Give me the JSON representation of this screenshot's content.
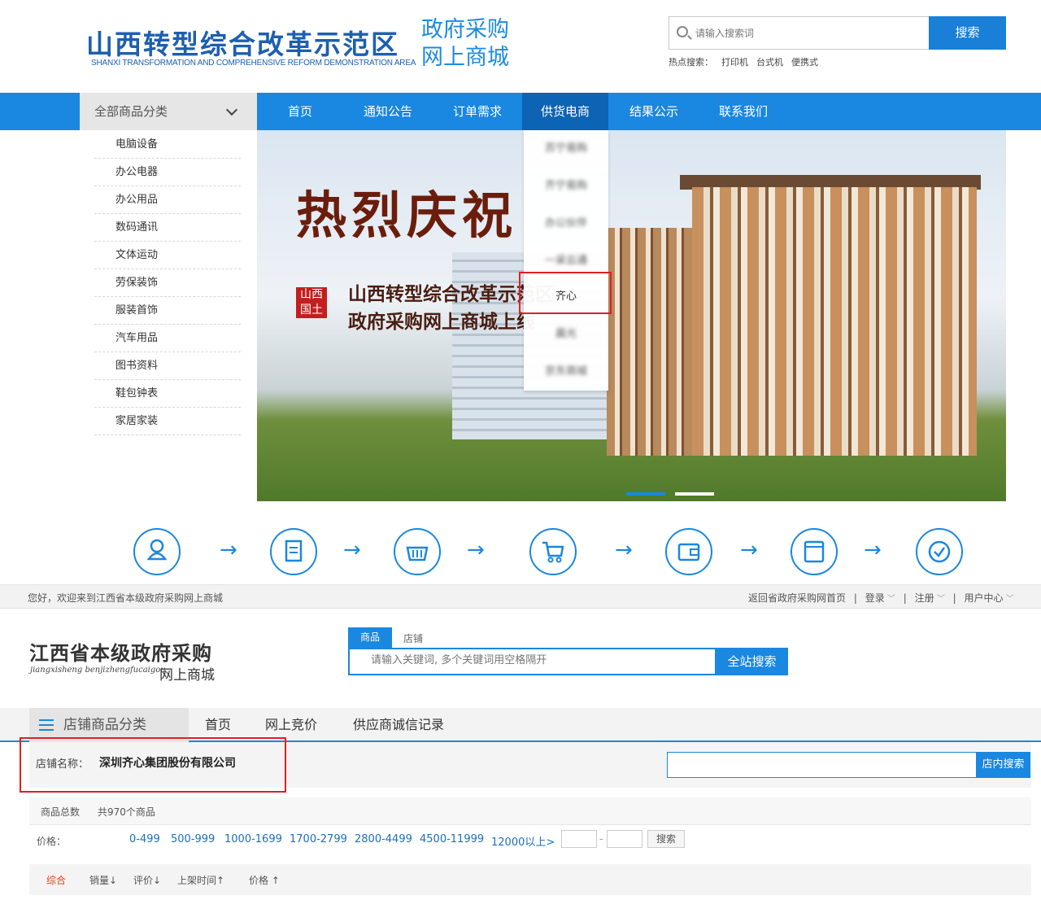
{
  "site1": {
    "logo_cn": "山西转型综合改革示范区",
    "logo_en": "SHANXI TRANSFORMATION AND COMPREHENSIVE REFORM DEMONSTRATION AREA",
    "logo_sub_line1": "政府采购",
    "logo_sub_line2": "网上商城",
    "search": {
      "placeholder": "请输入搜索词",
      "button": "搜索"
    },
    "hot_search_label": "热点搜索：",
    "hot_search": [
      "打印机",
      "台式机",
      "便携式"
    ],
    "category_header": "全部商品分类",
    "nav": [
      "首页",
      "通知公告",
      "订单需求",
      "供货电商",
      "结果公示",
      "联系我们"
    ],
    "nav_active": "供货电商",
    "categories": [
      "电脑设备",
      "办公电器",
      "办公用品",
      "数码通讯",
      "文体运动",
      "劳保装饰",
      "服装首饰",
      "汽车用品",
      "图书资料",
      "鞋包钟表",
      "家居家装"
    ],
    "banner": {
      "title": "热烈庆祝",
      "line1": "山西转型综合改革示范区",
      "line2": "政府采购网上商城上线",
      "seal": "山西\n国土"
    },
    "dropdown": [
      "苏宁易购",
      "齐宁易购",
      "办公伙伴",
      "一采云通",
      "齐心",
      "晨光",
      "京东商城"
    ],
    "dropdown_highlight": "齐心",
    "process_icons": [
      "user-icon",
      "document-icon",
      "basket-icon",
      "cart-icon",
      "wallet-icon",
      "box-icon",
      "check-icon"
    ],
    "arrow": "→"
  },
  "site2": {
    "welcome": "您好，欢迎来到江西省本级政府采购网上商城",
    "top_links": [
      "返回省政府采购网首页",
      "登录",
      "注册",
      "用户中心"
    ],
    "logo_line1": "江西省本级政府采购",
    "logo_pinyin": "jiangxisheng benjizhengfucaigou",
    "logo_line2": "网上商城",
    "search_tabs": [
      "商品",
      "店铺"
    ],
    "search_placeholder": "请输入关键词, 多个关键词用空格隔开",
    "search_button": "全站搜索",
    "category_label": "店铺商品分类",
    "nav": [
      "首页",
      "网上竞价",
      "供应商诚信记录"
    ],
    "shop_label": "店铺名称：",
    "shop_name": "深圳齐心集团股份有限公司",
    "shop_search_button": "店内搜索",
    "count_label": "商品总数",
    "count_value": "共970个商品",
    "price_label": "价格：",
    "price_ranges": [
      "0-499",
      "500-999",
      "1000-1699",
      "1700-2799",
      "2800-4499",
      "4500-11999",
      "12000以上>"
    ],
    "price_dash": "-",
    "price_search": "搜索",
    "sort": [
      "综合",
      "销量↓",
      "评价↓",
      "上架时间↑",
      "价格 ↑"
    ],
    "sort_active": "综合"
  },
  "colors": {
    "primary": "#1a87e0",
    "nav_active": "#0d63b4",
    "highlight": "#e02020",
    "sort_active": "#e2461b"
  }
}
